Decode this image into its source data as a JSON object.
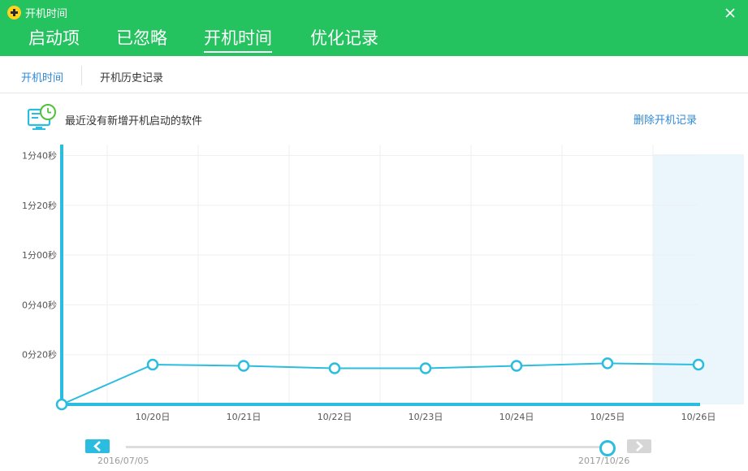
{
  "window": {
    "title": "开机时间",
    "logo_icon": "add-icon",
    "close_icon": "close-icon"
  },
  "main_tabs": [
    {
      "label": "启动项",
      "active": false
    },
    {
      "label": "已忽略",
      "active": false
    },
    {
      "label": "开机时间",
      "active": true
    },
    {
      "label": "优化记录",
      "active": false
    }
  ],
  "sub_tabs": [
    {
      "label": "开机时间",
      "active": true
    },
    {
      "label": "开机历史记录",
      "active": false
    }
  ],
  "info": {
    "icon": "monitor-clock-icon",
    "message": "最近没有新增开机启动的软件",
    "delete_link": "删除开机记录"
  },
  "colors": {
    "header": "#25c35f",
    "accent": "#2bbde0",
    "link": "#2f89d8",
    "highlight": "#eaf5fc"
  },
  "chart_data": {
    "type": "line",
    "categories": [
      "",
      "10/20日",
      "10/21日",
      "10/22日",
      "10/23日",
      "10/24日",
      "10/25日",
      "10/26日"
    ],
    "values": [
      0,
      16,
      15.5,
      14.5,
      14.5,
      15.5,
      16.5,
      16
    ],
    "y_ticks": [
      "0分20秒",
      "0分40秒",
      "1分00秒",
      "1分20秒",
      "1分40秒"
    ],
    "y_tick_values": [
      20,
      40,
      60,
      80,
      100
    ],
    "ylim": [
      0,
      100
    ],
    "unit": "seconds",
    "highlighted_category": "10/26日",
    "grid": true
  },
  "timeline": {
    "start_label": "2016/07/05",
    "end_label": "2017/10/26",
    "position": 1.0,
    "prev_icon": "chevron-left-icon",
    "next_icon": "chevron-right-icon"
  }
}
